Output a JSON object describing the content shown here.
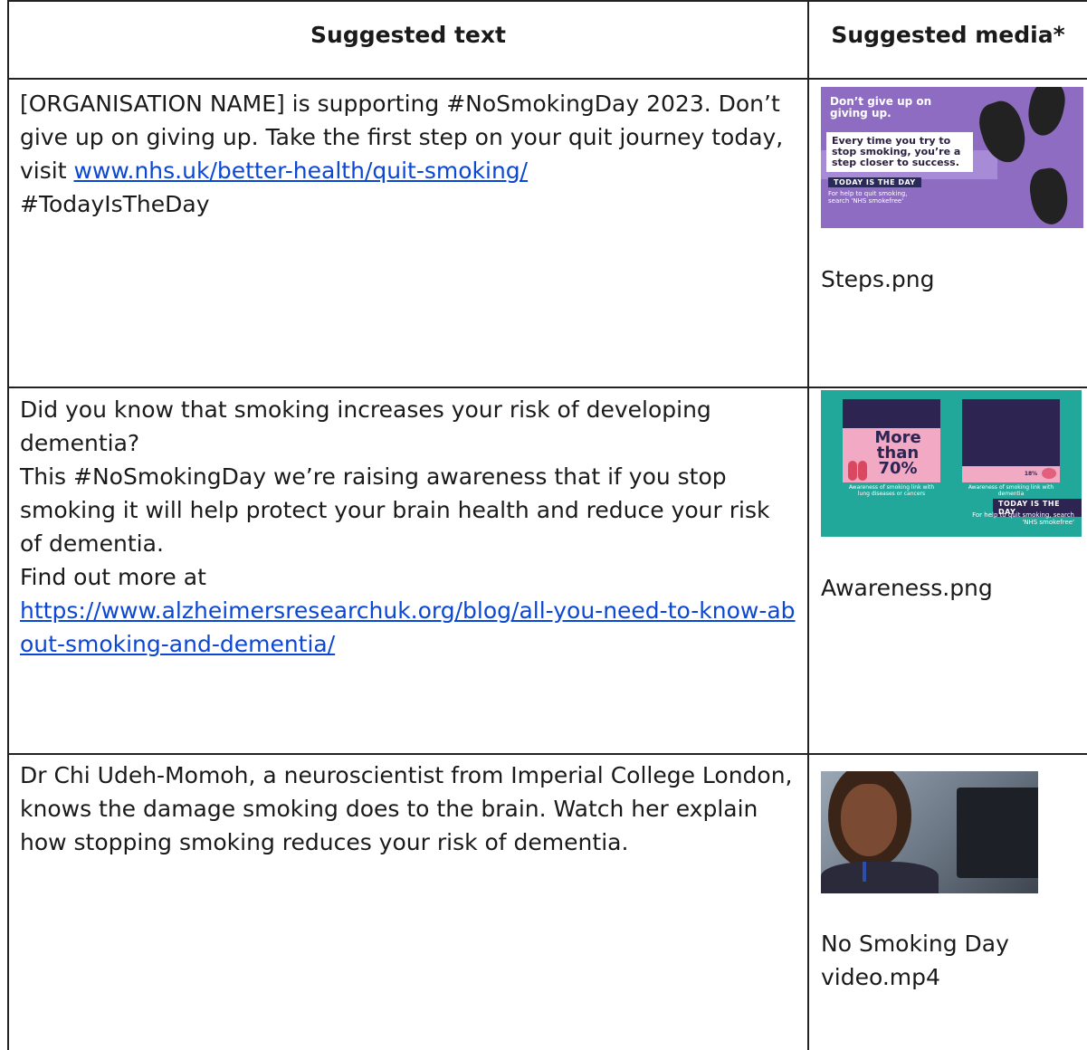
{
  "table": {
    "headers": {
      "text": "Suggested text",
      "media": "Suggested media*"
    },
    "rows": [
      {
        "text_parts": {
          "before_link": "[ORGANISATION NAME] is supporting #NoSmokingDay 2023. Don’t give up on giving up. Take the first step on your quit journey today, visit ",
          "link": "www.nhs.uk/better-health/quit-smoking/",
          "after_link": "#TodayIsTheDay"
        },
        "media": {
          "filename": "Steps.png",
          "thumbnail_text": {
            "headline": "Don’t give up on giving up.",
            "body": "Every time you try to stop smoking, you’re a step closer to success.",
            "tag": "TODAY IS THE DAY",
            "sub": "For help to quit smoking, search 'NHS smokefree'"
          },
          "colors": {
            "bg": "#8e6cc2"
          }
        }
      },
      {
        "paragraphs": [
          "Did you know that smoking increases your risk of developing dementia?",
          "This #NoSmokingDay we’re raising awareness that if you stop smoking it will help protect your brain health and reduce your risk of dementia.",
          "Find out more at"
        ],
        "link": "https://www.alzheimersresearchuk.org/blog/all-you-need-to-know-about-smoking-and-dementia/",
        "media": {
          "filename": "Awareness.png",
          "thumbnail_text": {
            "big": "More than 70%",
            "left_caption": "Awareness of smoking link with lung diseases or cancers",
            "right_value": "18%",
            "right_caption": "Awareness of smoking link with dementia",
            "tag": "TODAY IS THE DAY",
            "sub": "For help to quit smoking, search 'NHS smokefree'"
          },
          "colors": {
            "bg": "#21a89a",
            "panel": "#2d2452",
            "pink": "#f2a9c4"
          }
        }
      },
      {
        "paragraphs": [
          "Dr Chi Udeh-Momoh, a neuroscientist from Imperial College London, knows the damage smoking does to the brain. Watch her explain how stopping smoking reduces your risk of dementia."
        ],
        "media": {
          "filename_lines": [
            "No Smoking Day",
            "video.mp4"
          ]
        }
      }
    ]
  },
  "colors": {
    "link": "#0b47d4",
    "border": "#222222"
  }
}
